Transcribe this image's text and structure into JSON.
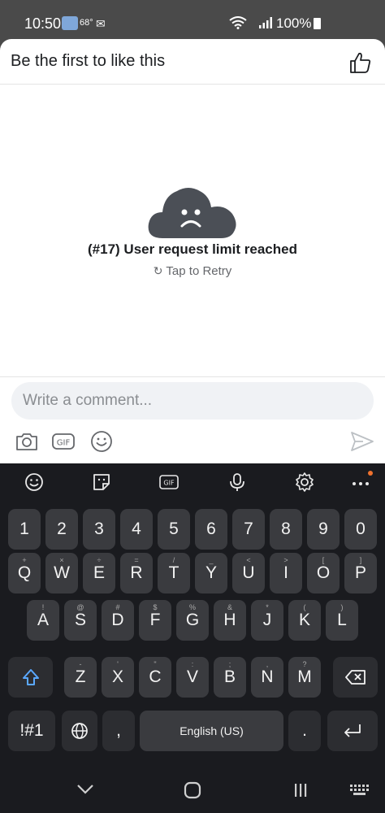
{
  "status_bar": {
    "time": "10:50",
    "temperature": "68°",
    "battery": "100%"
  },
  "sheet": {
    "title": "Be the first to like this",
    "error_message": "(#17) User request limit reached",
    "retry_label": "Tap to Retry",
    "comment_placeholder": "Write a comment..."
  },
  "composer_icons": [
    "camera-icon",
    "gif-icon",
    "emoji-icon",
    "send-icon"
  ],
  "keyboard": {
    "toolbar": [
      "emoji-icon",
      "sticker-icon",
      "gif-icon",
      "mic-icon",
      "settings-gear-icon",
      "more-icon"
    ],
    "gif_label": "GIF",
    "number_row": [
      "1",
      "2",
      "3",
      "4",
      "5",
      "6",
      "7",
      "8",
      "9",
      "0"
    ],
    "row1": [
      {
        "key": "Q",
        "hint": "+"
      },
      {
        "key": "W",
        "hint": "×"
      },
      {
        "key": "E",
        "hint": "÷"
      },
      {
        "key": "R",
        "hint": "="
      },
      {
        "key": "T",
        "hint": "/"
      },
      {
        "key": "Y",
        "hint": "_"
      },
      {
        "key": "U",
        "hint": "<"
      },
      {
        "key": "I",
        "hint": ">"
      },
      {
        "key": "O",
        "hint": "["
      },
      {
        "key": "P",
        "hint": "]"
      }
    ],
    "row2": [
      {
        "key": "A",
        "hint": "!"
      },
      {
        "key": "S",
        "hint": "@"
      },
      {
        "key": "D",
        "hint": "#"
      },
      {
        "key": "F",
        "hint": "$"
      },
      {
        "key": "G",
        "hint": "%"
      },
      {
        "key": "H",
        "hint": "&"
      },
      {
        "key": "J",
        "hint": "*"
      },
      {
        "key": "K",
        "hint": "("
      },
      {
        "key": "L",
        "hint": ")"
      }
    ],
    "row3": [
      {
        "key": "Z",
        "hint": "-"
      },
      {
        "key": "X",
        "hint": "'"
      },
      {
        "key": "C",
        "hint": "\""
      },
      {
        "key": "V",
        "hint": ":"
      },
      {
        "key": "B",
        "hint": ";"
      },
      {
        "key": "N",
        "hint": ","
      },
      {
        "key": "M",
        "hint": "?"
      }
    ],
    "symbols_label": "!#1",
    "comma_label": ",",
    "space_label": "English (US)",
    "period_label": "."
  },
  "nav_bar": [
    "back-chevron-icon",
    "home-icon",
    "recents-icon",
    "keyboard-switch-icon"
  ]
}
